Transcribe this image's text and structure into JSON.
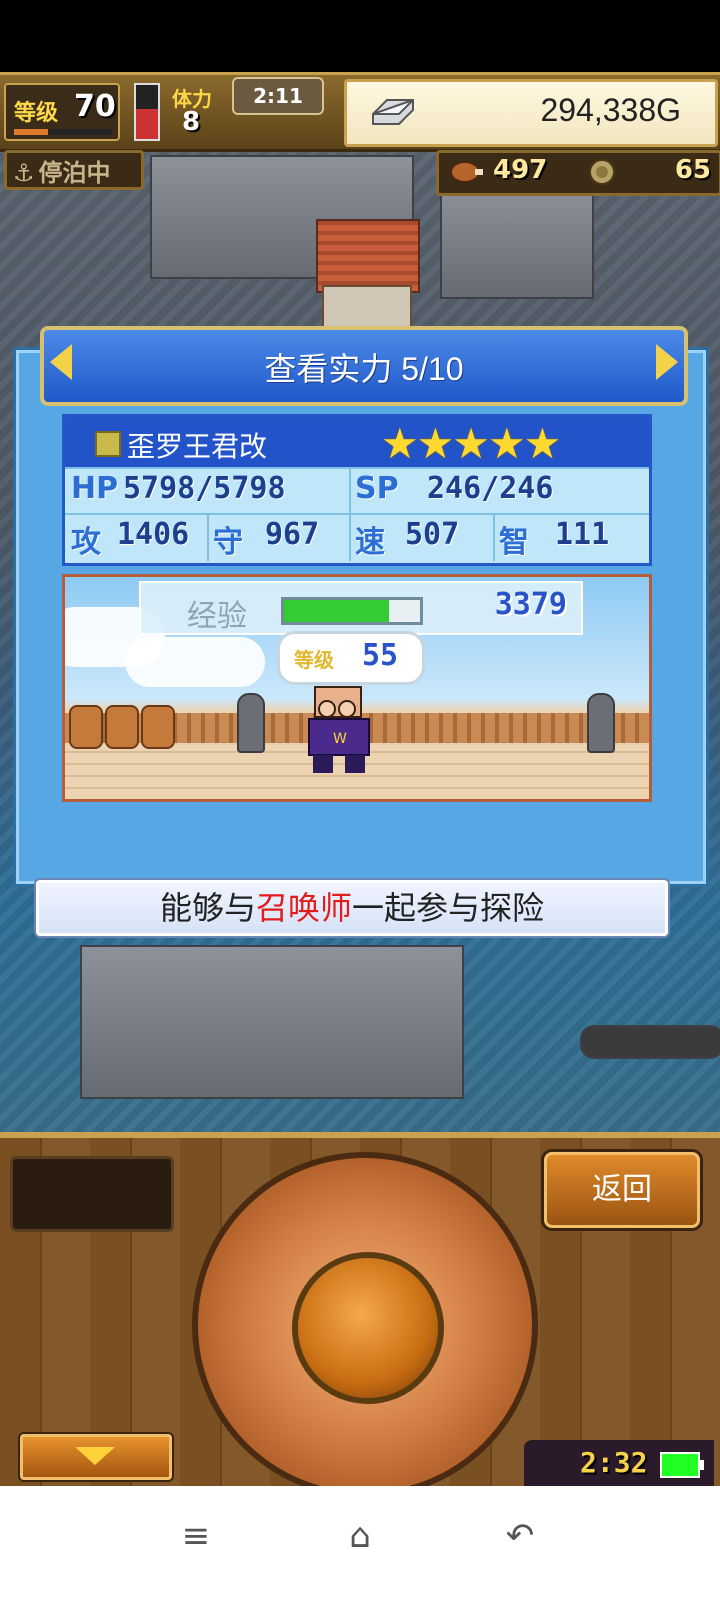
{
  "hud": {
    "level_label": "等级",
    "level_value": "70",
    "stamina_label": "体力",
    "stamina_value": "8",
    "timer": "2:11",
    "gold": "294,338G",
    "status": "停泊中",
    "food": "497",
    "coins": "65",
    "level_progress": 0.35,
    "stamina_fill": 0.55
  },
  "dialog": {
    "title": "查看实力 5/10",
    "name": "歪罗王君改",
    "stars": "★★★★★",
    "hp_label": "HP",
    "hp_value": "5798/5798",
    "sp_label": "SP",
    "sp_value": "246/246",
    "attack_label": "攻",
    "attack_value": "1406",
    "defense_label": "守",
    "defense_value": "967",
    "speed_label": "速",
    "speed_value": "507",
    "intellect_label": "智",
    "intellect_value": "111",
    "exp_label": "经验",
    "exp_value": "3379",
    "exp_fill": 0.77,
    "char_level_label": "等级",
    "char_level_value": "55"
  },
  "hint": {
    "part1": "能够与",
    "highlight": "召唤师",
    "part2": "一起参与探险",
    "highlight_color": "#e21b1b"
  },
  "panel": {
    "back_label": "返回",
    "clock": "2:32"
  },
  "icons": {
    "nav_menu": "≡",
    "nav_home": "⌂",
    "nav_back": "↶",
    "anchor": "⚓"
  }
}
